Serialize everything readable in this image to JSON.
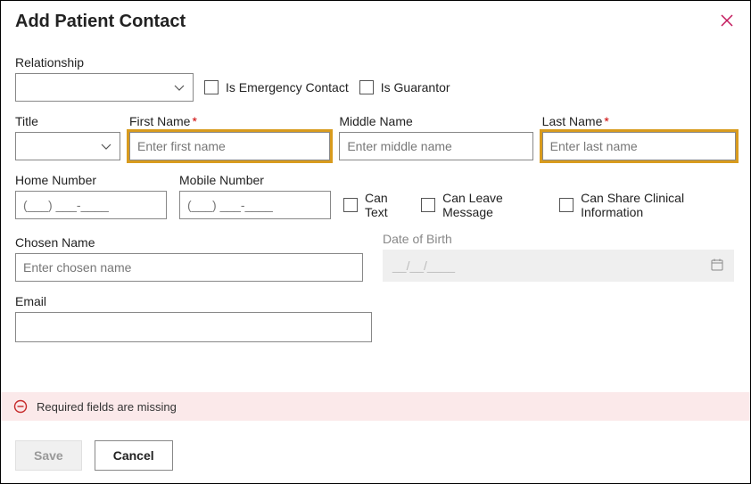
{
  "dialog": {
    "title": "Add Patient Contact"
  },
  "labels": {
    "relationship": "Relationship",
    "is_emergency": "Is Emergency Contact",
    "is_guarantor": "Is Guarantor",
    "title": "Title",
    "first_name": "First Name",
    "middle_name": "Middle Name",
    "last_name": "Last Name",
    "home_number": "Home Number",
    "mobile_number": "Mobile Number",
    "can_text": "Can Text",
    "can_leave_msg": "Can Leave Message",
    "can_share_clinical": "Can Share Clinical Information",
    "chosen_name": "Chosen Name",
    "dob": "Date of Birth",
    "email": "Email"
  },
  "placeholders": {
    "first_name": "Enter first name",
    "middle_name": "Enter middle name",
    "last_name": "Enter last name",
    "phone": "(___) ___-____",
    "chosen_name": "Enter chosen name",
    "dob": "__/__/____"
  },
  "error": {
    "message": "Required fields are missing"
  },
  "buttons": {
    "save": "Save",
    "cancel": "Cancel"
  },
  "required_marker": "*"
}
